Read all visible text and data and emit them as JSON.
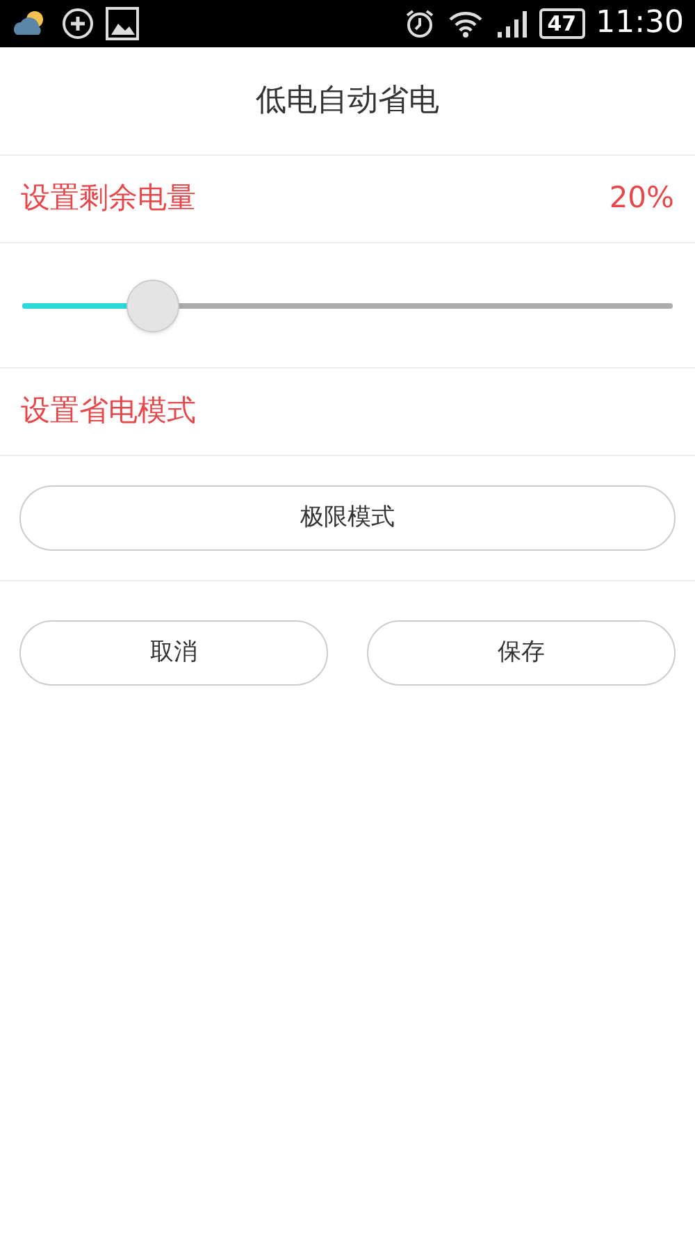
{
  "status_bar": {
    "battery": "47",
    "time": "11:30"
  },
  "title": "低电自动省电",
  "remaining": {
    "label": "设置剩余电量",
    "value": "20%",
    "level": 0.2
  },
  "mode": {
    "label": "设置省电模式",
    "button": "极限模式"
  },
  "buttons": [
    "取消",
    "保存"
  ]
}
